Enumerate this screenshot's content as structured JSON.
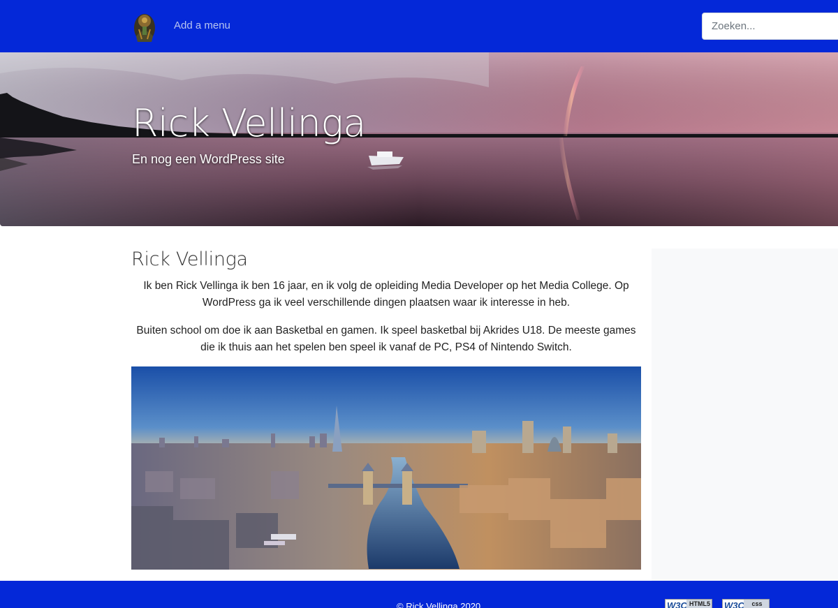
{
  "nav": {
    "logo_alt": "site logo",
    "menu_link": "Add a menu",
    "search_placeholder": "Zoeken..."
  },
  "hero": {
    "title": "Rick Vellinga",
    "subtitle": "En nog een WordPress site"
  },
  "article": {
    "title": "Rick Vellinga",
    "paragraphs": [
      "Ik ben Rick Vellinga ik ben 16 jaar, en ik volg de opleiding Media Developer op het Media College. Op WordPress ga ik veel verschillende dingen plaatsen waar ik interesse in heb.",
      "Buiten school om doe ik aan Basketbal en gamen. Ik speel basketbal bij Akrides U18. De meeste games die ik thuis aan het spelen ben speel ik vanaf de PC, PS4 of Nintendo Switch."
    ],
    "image_icon": "city-skyline-photo"
  },
  "footer": {
    "copyright": "© Rick Vellinga 2020",
    "badges": [
      {
        "brand": "W3C",
        "label": "HTML5"
      },
      {
        "brand": "W3C",
        "label": "css"
      }
    ]
  },
  "colors": {
    "brand_blue": "#0428d8",
    "sidebar_bg": "#f8f9fa"
  }
}
